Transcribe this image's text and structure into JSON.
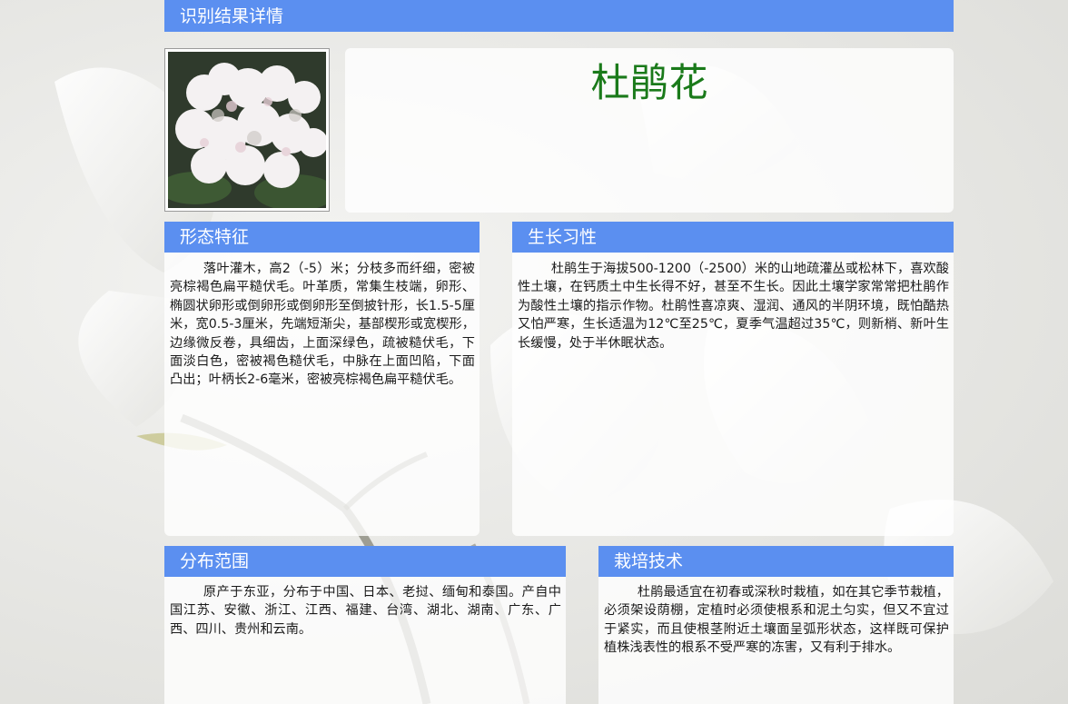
{
  "page": {
    "title": "识别结果详情"
  },
  "result": {
    "name": "杜鹃花",
    "image_alt": "rhododendron-photo"
  },
  "sections": {
    "morphology": {
      "title": "形态特征",
      "text": "落叶灌木，高2（-5）米；分枝多而纤细，密被亮棕褐色扁平糙伏毛。叶革质，常集生枝端，卵形、椭圆状卵形或倒卵形或倒卵形至倒披针形，长1.5-5厘米，宽0.5-3厘米，先端短渐尖，基部楔形或宽楔形，边缘微反卷，具细齿，上面深绿色，疏被糙伏毛，下面淡白色，密被褐色糙伏毛，中脉在上面凹陷，下面凸出；叶柄长2-6毫米，密被亮棕褐色扁平糙伏毛。"
    },
    "habit": {
      "title": "生长习性",
      "text": "杜鹃生于海拔500-1200（-2500）米的山地疏灌丛或松林下，喜欢酸性土壤，在钙质土中生长得不好，甚至不生长。因此土壤学家常常把杜鹃作为酸性土壤的指示作物。杜鹃性喜凉爽、湿润、通风的半阴环境，既怕酷热又怕严寒，生长适温为12℃至25℃，夏季气温超过35℃，则新梢、新叶生长缓慢，处于半休眠状态。"
    },
    "distribution": {
      "title": "分布范围",
      "text": "原产于东亚，分布于中国、日本、老挝、缅甸和泰国。产自中国江苏、安徽、浙江、江西、福建、台湾、湖北、湖南、广东、广西、四川、贵州和云南。"
    },
    "cultivation": {
      "title": "栽培技术",
      "text": "杜鹃最适宜在初春或深秋时栽植，如在其它季节栽植，必须架设荫棚，定植时必须使根系和泥土匀实，但又不宜过于紧实，而且使根茎附近土壤面呈弧形状态，这样既可保护植株浅表性的根系不受严寒的冻害，又有利于排水。"
    }
  },
  "colors": {
    "header_blue": "#5b8ff0",
    "name_green": "#1a7a1a",
    "header_text": "#ffffff"
  }
}
